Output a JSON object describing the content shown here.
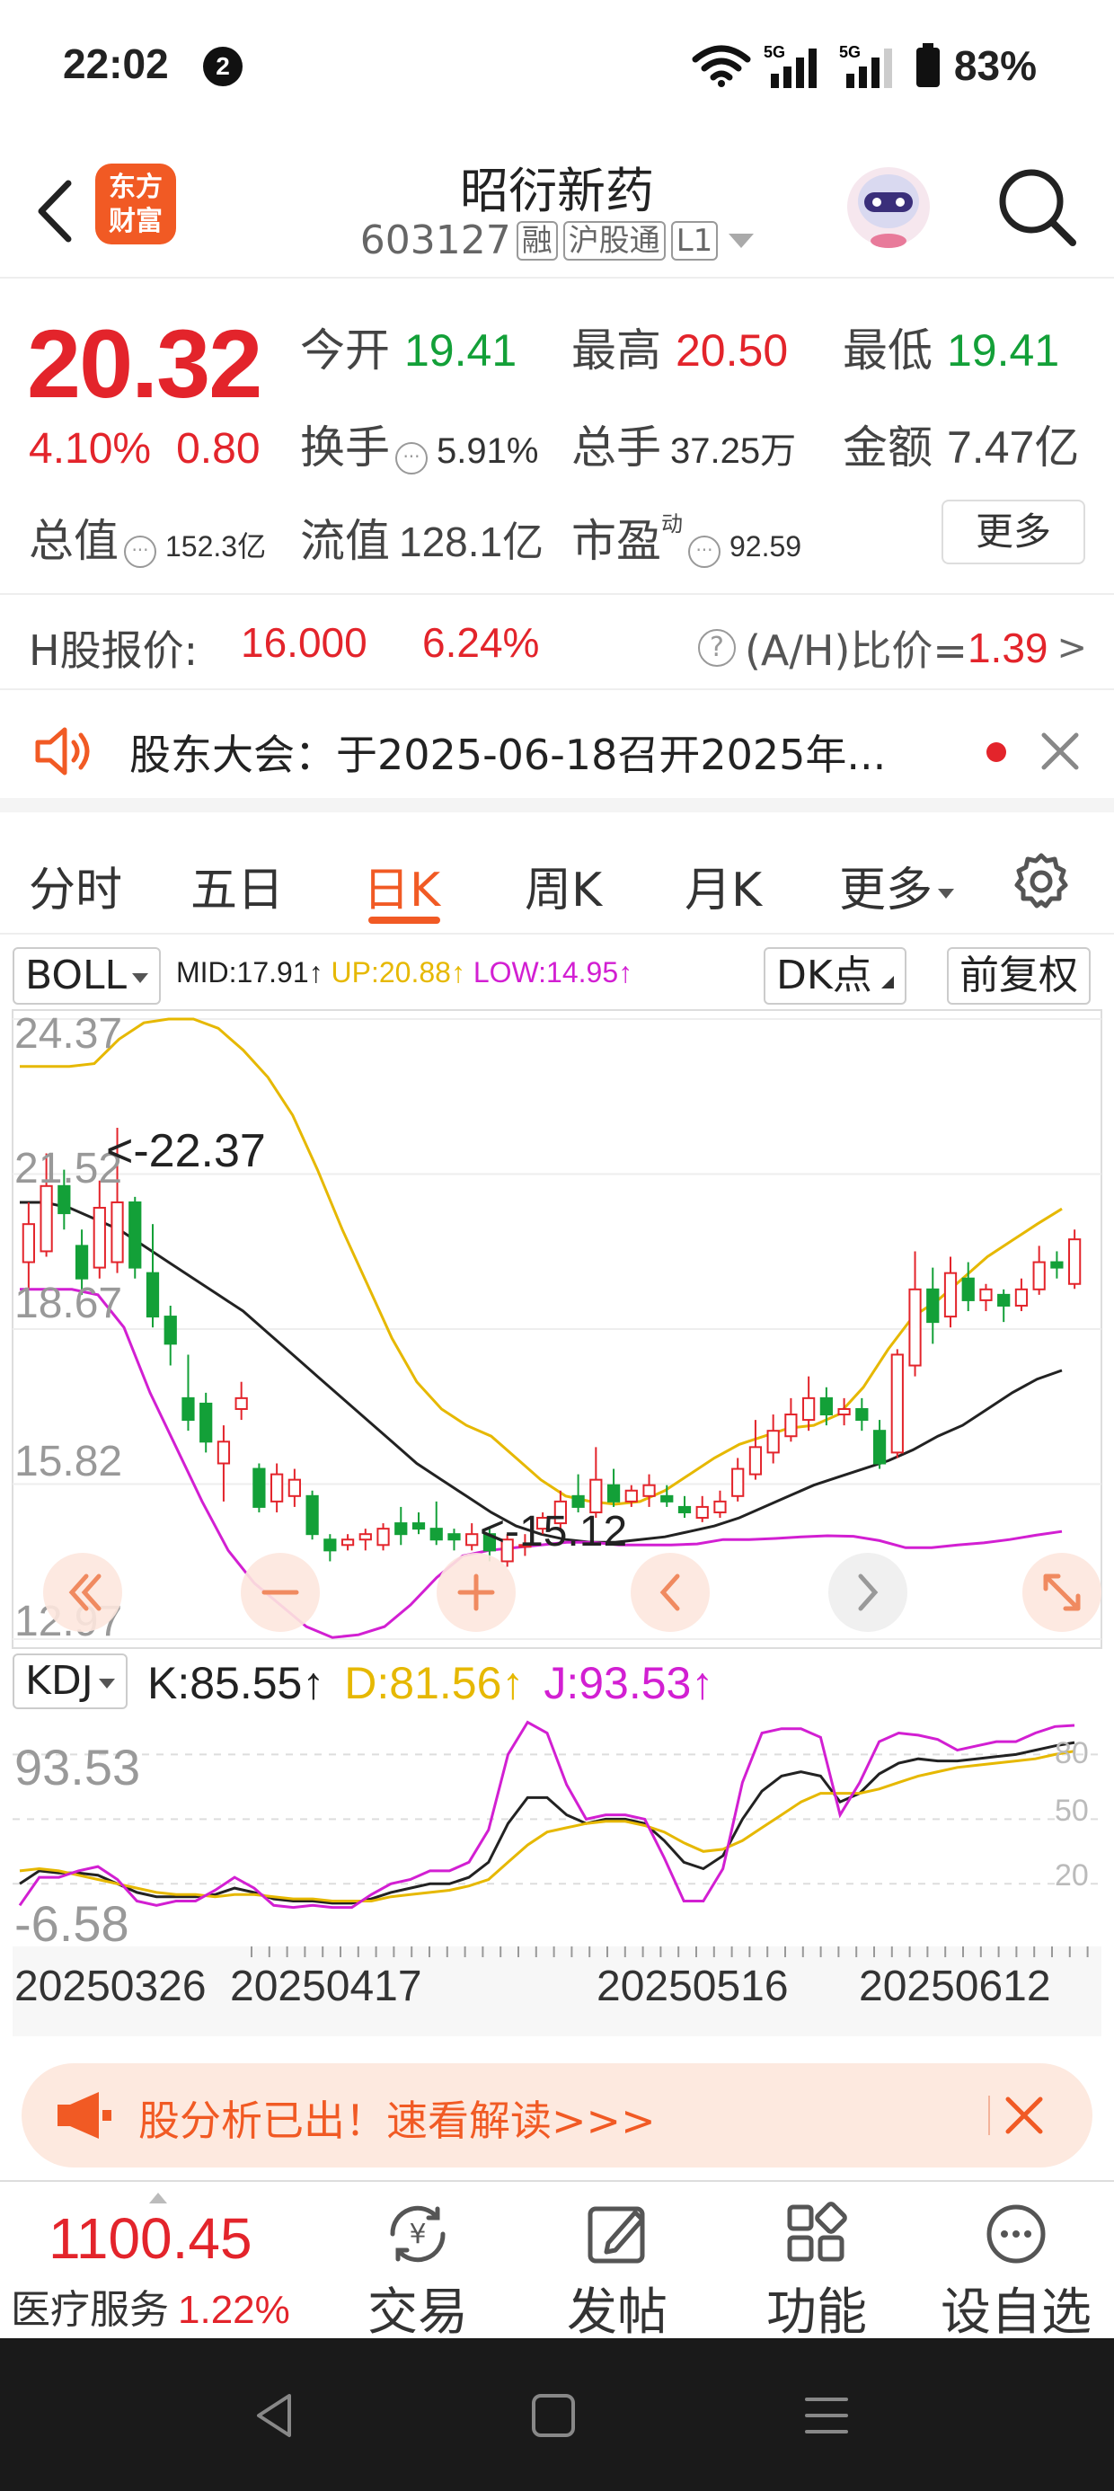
{
  "status": {
    "time": "22:02",
    "badge": "2",
    "battery": "83%",
    "net1": "5G",
    "net2": "5G"
  },
  "header": {
    "app_logo_line1": "东方",
    "app_logo_line2": "财富",
    "stock_name": "昭衍新药",
    "stock_code": "603127",
    "tags": [
      "融",
      "沪股通",
      "L1"
    ]
  },
  "quote": {
    "price": "20.32",
    "change_pct": "4.10%",
    "change_amt": "0.80",
    "open_label": "今开",
    "open": "19.41",
    "high_label": "最高",
    "high": "20.50",
    "low_label": "最低",
    "low": "19.41",
    "turnover_label": "换手",
    "turnover": "5.91%",
    "volume_label": "总手",
    "volume": "37.25万",
    "amount_label": "金额",
    "amount": "7.47亿",
    "total_cap_label": "总值",
    "total_cap": "152.3亿",
    "float_cap_label": "流值",
    "float_cap": "128.1亿",
    "pe_label": "市盈",
    "pe_sup": "动",
    "pe": "92.59",
    "more": "更多"
  },
  "hshare": {
    "label": "H股报价:",
    "price": "16.000",
    "pct": "6.24%",
    "ratio_label": "(A/H)比价=",
    "ratio": "1.39",
    "arrow": ">"
  },
  "notice": {
    "text": "股东大会：于2025-06-18召开2025年..."
  },
  "tabs": [
    "分时",
    "五日",
    "日K",
    "周K",
    "月K",
    "更多"
  ],
  "active_tab_index": 2,
  "boll": {
    "selector": "BOLL",
    "mid": "MID:17.91↑",
    "up": "UP:20.88↑",
    "low": "LOW:14.95↑",
    "dk_button": "DK点",
    "adjust_button": "前复权",
    "y_labels": [
      "24.37",
      "21.52",
      "18.67",
      "15.82",
      "12.97"
    ],
    "max_marker": "<-22.37",
    "min_marker": "<-15.12"
  },
  "kdj": {
    "selector": "KDJ",
    "k": "K:85.55↑",
    "d": "D:81.56↑",
    "j": "J:93.53↑",
    "y_left": [
      "93.53",
      "-6.58"
    ],
    "y_right": [
      "80",
      "50",
      "20"
    ],
    "dates": [
      "20250326",
      "20250417",
      "20250516",
      "20250612"
    ]
  },
  "colors": {
    "up": "#e3242b",
    "down": "#13a038",
    "accent": "#f15a24",
    "mid": "#222222",
    "upper": "#e6b800",
    "lower": "#d21fd2"
  },
  "promo": {
    "text": "股分析已出！速看解读>>>"
  },
  "bottom": {
    "index_price": "1100.45",
    "index_name": "医疗服务",
    "index_pct": "1.22%",
    "nav": [
      "交易",
      "发帖",
      "功能",
      "设自选"
    ]
  },
  "chart_data": [
    {
      "type": "candlestick",
      "title": "BOLL",
      "ylim": [
        12.97,
        24.37
      ],
      "y_ticks": [
        24.37,
        21.52,
        18.67,
        15.82,
        12.97
      ],
      "x_ticks": [
        "20250326",
        "20250417",
        "20250516",
        "20250612"
      ],
      "annotations": [
        "<-22.37",
        "<-15.12"
      ],
      "candles": [
        {
          "o": 19.9,
          "c": 20.6,
          "h": 21.0,
          "l": 19.4
        },
        {
          "o": 20.1,
          "c": 21.3,
          "h": 21.9,
          "l": 20.0
        },
        {
          "o": 21.3,
          "c": 20.8,
          "h": 21.6,
          "l": 20.5
        },
        {
          "o": 20.2,
          "c": 19.6,
          "h": 20.5,
          "l": 19.3
        },
        {
          "o": 19.8,
          "c": 20.9,
          "h": 21.4,
          "l": 19.6
        },
        {
          "o": 19.9,
          "c": 21.0,
          "h": 22.37,
          "l": 19.7
        },
        {
          "o": 21.0,
          "c": 19.8,
          "h": 21.1,
          "l": 19.6
        },
        {
          "o": 19.7,
          "c": 18.9,
          "h": 20.6,
          "l": 18.7
        },
        {
          "o": 18.9,
          "c": 18.4,
          "h": 19.1,
          "l": 18.0
        },
        {
          "o": 17.4,
          "c": 17.0,
          "h": 18.2,
          "l": 16.8
        },
        {
          "o": 17.3,
          "c": 16.6,
          "h": 17.5,
          "l": 16.4
        },
        {
          "o": 16.2,
          "c": 16.6,
          "h": 16.9,
          "l": 15.5
        },
        {
          "o": 17.2,
          "c": 17.4,
          "h": 17.7,
          "l": 17.0
        },
        {
          "o": 16.1,
          "c": 15.4,
          "h": 16.2,
          "l": 15.3
        },
        {
          "o": 15.5,
          "c": 16.0,
          "h": 16.2,
          "l": 15.3
        },
        {
          "o": 15.6,
          "c": 15.9,
          "h": 16.1,
          "l": 15.4
        },
        {
          "o": 15.6,
          "c": 14.9,
          "h": 15.7,
          "l": 14.8
        },
        {
          "o": 14.8,
          "c": 14.6,
          "h": 14.9,
          "l": 14.4
        },
        {
          "o": 14.7,
          "c": 14.8,
          "h": 14.9,
          "l": 14.6
        },
        {
          "o": 14.8,
          "c": 14.9,
          "h": 15.0,
          "l": 14.6
        },
        {
          "o": 14.7,
          "c": 15.0,
          "h": 15.1,
          "l": 14.6
        },
        {
          "o": 15.1,
          "c": 14.9,
          "h": 15.4,
          "l": 14.7
        },
        {
          "o": 15.1,
          "c": 15.0,
          "h": 15.3,
          "l": 14.9
        },
        {
          "o": 15.0,
          "c": 14.8,
          "h": 15.5,
          "l": 14.7
        },
        {
          "o": 14.9,
          "c": 14.8,
          "h": 15.0,
          "l": 14.6
        },
        {
          "o": 14.7,
          "c": 14.9,
          "h": 15.1,
          "l": 14.6
        },
        {
          "o": 14.9,
          "c": 14.6,
          "h": 15.0,
          "l": 14.4
        },
        {
          "o": 14.4,
          "c": 14.8,
          "h": 14.9,
          "l": 14.3
        },
        {
          "o": 14.7,
          "c": 14.7,
          "h": 14.9,
          "l": 14.5
        },
        {
          "o": 15.0,
          "c": 15.2,
          "h": 15.3,
          "l": 14.9
        },
        {
          "o": 15.1,
          "c": 15.5,
          "h": 15.7,
          "l": 15.0
        },
        {
          "o": 15.6,
          "c": 15.4,
          "h": 16.0,
          "l": 15.3
        },
        {
          "o": 15.3,
          "c": 15.9,
          "h": 16.5,
          "l": 15.2
        },
        {
          "o": 15.8,
          "c": 15.5,
          "h": 16.1,
          "l": 15.4
        },
        {
          "o": 15.5,
          "c": 15.7,
          "h": 15.8,
          "l": 15.4
        },
        {
          "o": 15.6,
          "c": 15.8,
          "h": 16.0,
          "l": 15.4
        },
        {
          "o": 15.6,
          "c": 15.5,
          "h": 15.8,
          "l": 15.4
        },
        {
          "o": 15.4,
          "c": 15.3,
          "h": 15.6,
          "l": 15.2
        },
        {
          "o": 15.2,
          "c": 15.4,
          "h": 15.6,
          "l": 15.12
        },
        {
          "o": 15.3,
          "c": 15.5,
          "h": 15.7,
          "l": 15.2
        },
        {
          "o": 15.6,
          "c": 16.1,
          "h": 16.3,
          "l": 15.5
        },
        {
          "o": 16.0,
          "c": 16.5,
          "h": 17.0,
          "l": 15.9
        },
        {
          "o": 16.4,
          "c": 16.8,
          "h": 17.1,
          "l": 16.2
        },
        {
          "o": 16.7,
          "c": 17.1,
          "h": 17.4,
          "l": 16.6
        },
        {
          "o": 17.0,
          "c": 17.4,
          "h": 17.8,
          "l": 16.8
        },
        {
          "o": 17.4,
          "c": 17.1,
          "h": 17.6,
          "l": 16.9
        },
        {
          "o": 17.1,
          "c": 17.2,
          "h": 17.4,
          "l": 16.9
        },
        {
          "o": 17.2,
          "c": 17.0,
          "h": 17.4,
          "l": 16.8
        },
        {
          "o": 16.8,
          "c": 16.2,
          "h": 17.0,
          "l": 16.1
        },
        {
          "o": 16.4,
          "c": 18.2,
          "h": 18.3,
          "l": 16.3
        },
        {
          "o": 18.0,
          "c": 19.4,
          "h": 20.1,
          "l": 17.8
        },
        {
          "o": 19.4,
          "c": 18.8,
          "h": 19.8,
          "l": 18.4
        },
        {
          "o": 18.9,
          "c": 19.7,
          "h": 20.0,
          "l": 18.7
        },
        {
          "o": 19.6,
          "c": 19.2,
          "h": 19.9,
          "l": 19.0
        },
        {
          "o": 19.2,
          "c": 19.4,
          "h": 19.5,
          "l": 19.0
        },
        {
          "o": 19.3,
          "c": 19.1,
          "h": 19.4,
          "l": 18.8
        },
        {
          "o": 19.1,
          "c": 19.4,
          "h": 19.6,
          "l": 19.0
        },
        {
          "o": 19.4,
          "c": 19.9,
          "h": 20.2,
          "l": 19.3
        },
        {
          "o": 19.9,
          "c": 19.8,
          "h": 20.1,
          "l": 19.6
        },
        {
          "o": 19.5,
          "c": 20.32,
          "h": 20.5,
          "l": 19.41
        }
      ],
      "series": [
        {
          "name": "MID",
          "values": [
            21.0,
            21.0,
            20.9,
            20.7,
            20.5,
            20.2,
            19.9,
            19.6,
            19.3,
            19.0,
            18.6,
            18.2,
            17.8,
            17.4,
            17.0,
            16.6,
            16.2,
            15.9,
            15.6,
            15.3,
            15.05,
            14.9,
            14.8,
            14.75,
            14.75,
            14.8,
            14.85,
            14.95,
            15.05,
            15.2,
            15.4,
            15.6,
            15.8,
            15.95,
            16.1,
            16.25,
            16.45,
            16.7,
            16.9,
            17.2,
            17.5,
            17.75,
            17.91
          ]
        },
        {
          "name": "UP",
          "values": [
            23.5,
            23.5,
            23.5,
            23.55,
            24.0,
            24.3,
            24.37,
            24.37,
            24.2,
            23.8,
            23.3,
            22.6,
            21.6,
            20.5,
            19.5,
            18.5,
            17.7,
            17.2,
            16.9,
            16.7,
            16.3,
            15.9,
            15.6,
            15.5,
            15.45,
            15.5,
            15.7,
            16.0,
            16.3,
            16.55,
            16.7,
            16.85,
            16.9,
            17.1,
            17.6,
            18.3,
            18.9,
            19.2,
            19.6,
            20.0,
            20.3,
            20.6,
            20.88
          ]
        },
        {
          "name": "LOW",
          "values": [
            19.4,
            19.4,
            19.4,
            19.3,
            18.7,
            17.5,
            16.5,
            15.5,
            14.6,
            14.0,
            13.6,
            13.2,
            13.0,
            13.05,
            13.2,
            13.6,
            14.1,
            14.5,
            14.6,
            14.65,
            14.7,
            14.75,
            14.75,
            14.7,
            14.7,
            14.7,
            14.72,
            14.8,
            14.8,
            14.82,
            14.85,
            14.87,
            14.86,
            14.78,
            14.65,
            14.65,
            14.7,
            14.74,
            14.8,
            14.88,
            14.95
          ]
        }
      ]
    },
    {
      "type": "line",
      "title": "KDJ",
      "ylim": [
        -6.58,
        93.53
      ],
      "right_ticks": [
        80,
        50,
        20
      ],
      "series": [
        {
          "name": "K",
          "values": [
            20,
            26,
            25,
            25,
            24,
            20,
            16,
            14,
            14,
            14,
            15,
            18,
            16,
            13,
            12,
            12,
            11,
            11,
            13,
            16,
            18,
            20,
            20,
            23,
            30,
            48,
            60,
            60,
            52,
            48,
            50,
            50,
            48,
            40,
            30,
            27,
            33,
            50,
            63,
            70,
            72,
            70,
            58,
            62,
            71,
            76,
            78,
            77,
            77,
            78,
            79,
            80,
            82,
            84,
            85.55
          ]
        },
        {
          "name": "D",
          "values": [
            26,
            27,
            26,
            24,
            22,
            20,
            18,
            16,
            15,
            15,
            14,
            15,
            15,
            14,
            13,
            13,
            12,
            12,
            12,
            14,
            15,
            16,
            17,
            19,
            22,
            30,
            38,
            44,
            46,
            48,
            49,
            49,
            47,
            44,
            39,
            35,
            36,
            40,
            46,
            52,
            58,
            62,
            62,
            62,
            64,
            67,
            70,
            72,
            74,
            75,
            76,
            77,
            78,
            80,
            81.56
          ]
        },
        {
          "name": "J",
          "values": [
            10,
            23,
            23,
            26,
            28,
            22,
            12,
            10,
            12,
            12,
            17,
            23,
            18,
            10,
            9,
            10,
            9,
            9,
            15,
            20,
            22,
            26,
            26,
            30,
            45,
            80,
            95,
            90,
            66,
            50,
            52,
            52,
            50,
            32,
            12,
            12,
            27,
            67,
            90,
            92,
            92,
            88,
            52,
            67,
            86,
            90,
            89,
            87,
            82,
            84,
            86,
            86,
            90,
            93,
            93.53
          ]
        }
      ]
    }
  ]
}
